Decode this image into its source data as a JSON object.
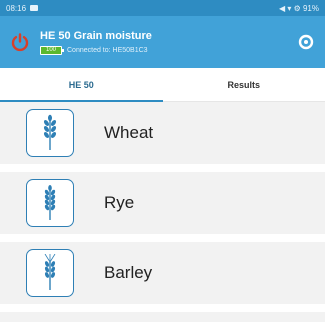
{
  "status_bar": {
    "time": "08:16",
    "right_text": "◀ ▾ ⚙ 91%"
  },
  "app_bar": {
    "title": "HE 50 Grain moisture",
    "battery_label": "100",
    "battery_level": 1.0,
    "connection": "Connected to: HE50B1C3"
  },
  "tabs": [
    {
      "label": "HE 50",
      "active": true
    },
    {
      "label": "Results",
      "active": false
    }
  ],
  "grains": [
    {
      "label": "Wheat",
      "icon": "wheat-icon"
    },
    {
      "label": "Rye",
      "icon": "rye-icon"
    },
    {
      "label": "Barley",
      "icon": "barley-icon"
    }
  ],
  "colors": {
    "status_bar": "#2e8cc2",
    "app_bar": "#41a2d8",
    "power_icon": "#d8402a",
    "accent": "#2e8cc2",
    "battery_fill": "#5cb82e"
  }
}
